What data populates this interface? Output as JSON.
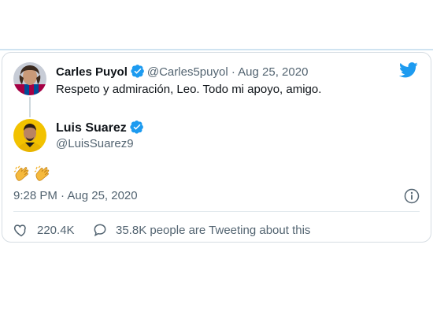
{
  "quoted": {
    "name": "Carles Puyol",
    "handle": "@Carles5puyol",
    "separator": "·",
    "date": "Aug 25, 2020",
    "text": "Respeto y admiración, Leo. Todo mi apoyo, amigo."
  },
  "tweet": {
    "name": "Luis Suarez",
    "handle": "@LuisSuarez9",
    "content_emoji": [
      "clapping-hands",
      "clapping-hands"
    ],
    "timestamp": "9:28 PM · Aug 25, 2020",
    "likes": "220.4K",
    "replies_text": "35.8K people are Tweeting about this"
  },
  "colors": {
    "twitter_blue": "#1d9bf0",
    "verified_blue": "#1d9bf0",
    "muted_text": "#536471",
    "border": "#d6dde3"
  },
  "icons": [
    "twitter-logo-icon",
    "verified-icon",
    "info-icon",
    "heart-icon",
    "reply-icon",
    "clapping-hands-icon"
  ]
}
